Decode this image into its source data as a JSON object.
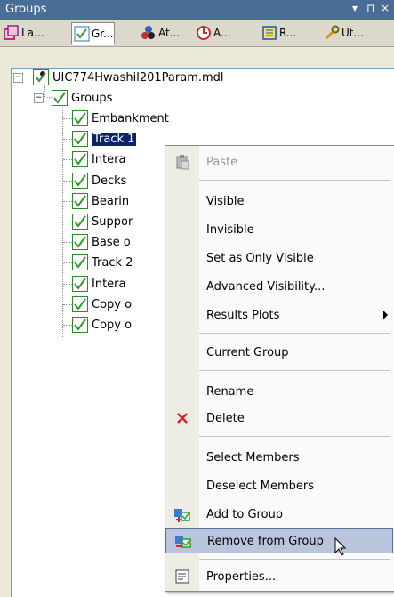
{
  "window": {
    "title": "Groups",
    "dropdown_glyph": "▾",
    "pin_glyph": "⊓",
    "close_glyph": "×"
  },
  "tabs": [
    {
      "label": "La...",
      "icon": "layers-icon",
      "color": "#c03070"
    },
    {
      "label": "Gr...",
      "icon": "groups-icon",
      "color": "#2f9a2f"
    },
    {
      "label": "At...",
      "icon": "attributes-icon",
      "color": "#c03030"
    },
    {
      "label": "A...",
      "icon": "analysis-icon",
      "color": "#c03030"
    },
    {
      "label": "R...",
      "icon": "results-icon",
      "color": "#2050c0"
    },
    {
      "label": "Ut...",
      "icon": "utilities-icon",
      "color": "#d0a000"
    }
  ],
  "tree": {
    "root": "UIC774Hwashil201Param.mdl",
    "groups_label": "Groups",
    "items": [
      "Embankment",
      "Track 1",
      "Intera",
      "Decks",
      "Bearin",
      "Suppor",
      "Base o",
      "Track 2",
      "Intera",
      "Copy o",
      "Copy o"
    ],
    "selected_index": 1
  },
  "context_menu": {
    "items": {
      "paste": "Paste",
      "visible": "Visible",
      "invisible": "Invisible",
      "only_visible": "Set as Only Visible",
      "advanced": "Advanced Visibility...",
      "results_plots": "Results Plots",
      "current_group": "Current Group",
      "rename": "Rename",
      "delete": "Delete",
      "select_members": "Select Members",
      "deselect_members": "Deselect Members",
      "add_to_group": "Add to Group",
      "remove_from_group": "Remove from Group",
      "properties": "Properties..."
    }
  },
  "colors": {
    "titlebar": "#4a6d97",
    "selection": "#0a246a",
    "hover": "#b9c5dd",
    "check_green": "#2f9a2f",
    "delete_red": "#e02020"
  }
}
